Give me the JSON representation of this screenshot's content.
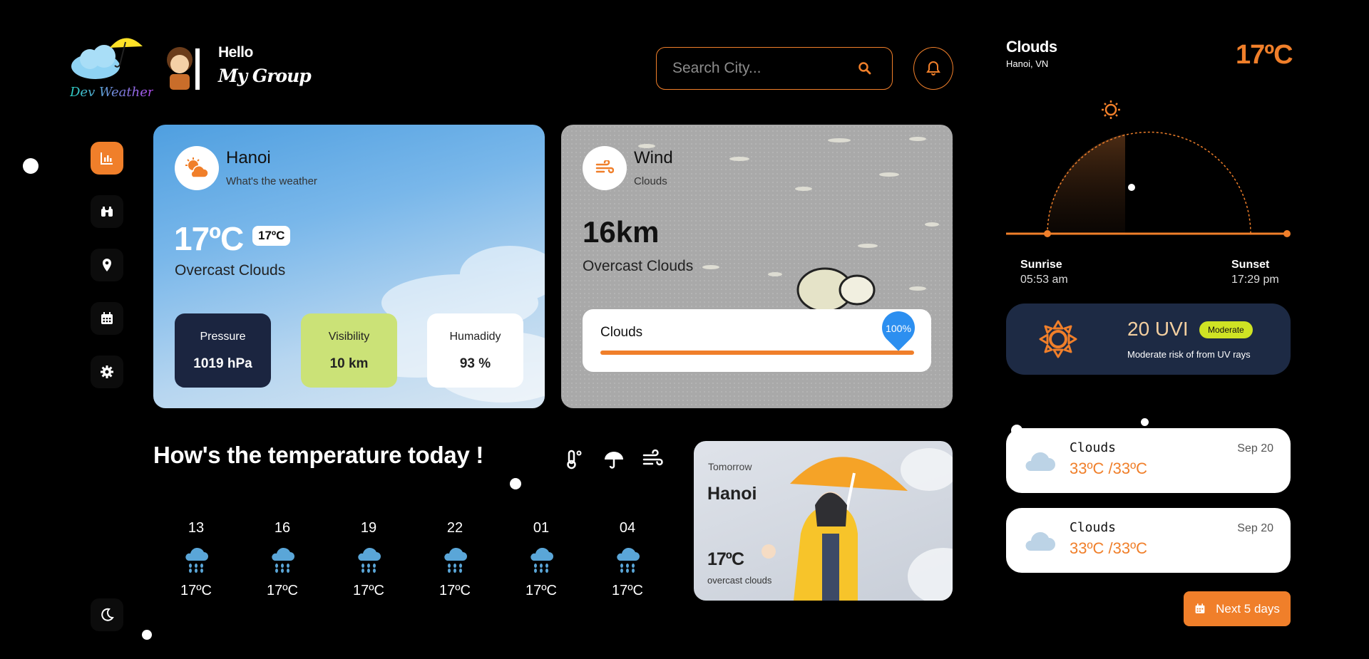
{
  "brand": {
    "logo_text": "Dev Weather"
  },
  "greeting": {
    "hello": "Hello",
    "group": "My Group"
  },
  "search": {
    "placeholder": "Search City..."
  },
  "main_card": {
    "city": "Hanoi",
    "subtitle": "What's the weather",
    "temp": "17ºC",
    "temp_chip": "17ºC",
    "description": "Overcast Clouds",
    "stats": [
      {
        "label": "Pressure",
        "value": "1019 hPa"
      },
      {
        "label": "Visibility",
        "value": "10 km"
      },
      {
        "label": "Humadidy",
        "value": "93 %"
      }
    ]
  },
  "wind_card": {
    "title": "Wind",
    "subtitle": "Clouds",
    "speed": "16km",
    "description": "Overcast Clouds",
    "bar_label": "Clouds",
    "bar_percent": "100%"
  },
  "today": {
    "title": "How's the temperature today !",
    "hours": [
      {
        "hour": "13",
        "temp": "17ºC"
      },
      {
        "hour": "16",
        "temp": "17ºC"
      },
      {
        "hour": "19",
        "temp": "17ºC"
      },
      {
        "hour": "22",
        "temp": "17ºC"
      },
      {
        "hour": "01",
        "temp": "17ºC"
      },
      {
        "hour": "04",
        "temp": "17ºC"
      }
    ]
  },
  "tomorrow": {
    "label": "Tomorrow",
    "city": "Hanoi",
    "temp": "17ºC",
    "description": "overcast clouds"
  },
  "right_panel": {
    "condition": "Clouds",
    "location": "Hanoi, VN",
    "temp": "17ºC",
    "sunrise_label": "Sunrise",
    "sunrise_time": "05:53 am",
    "sunset_label": "Sunset",
    "sunset_time": "17:29 pm",
    "uv_value": "20 UVI",
    "uv_level": "Moderate",
    "uv_desc": "Moderate risk of from UV rays",
    "forecast": [
      {
        "name": "Clouds",
        "temp": "33ºC /33ºC",
        "date": "Sep 20"
      },
      {
        "name": "Clouds",
        "temp": "33ºC /33ºC",
        "date": "Sep 20"
      }
    ],
    "next_button": "Next 5 days"
  },
  "colors": {
    "accent": "#f07f2a",
    "uv_card": "#1d2a44",
    "stat_dark": "#1b2540",
    "stat_lime": "#cbe277",
    "rain_icon": "#5aa6d8"
  }
}
